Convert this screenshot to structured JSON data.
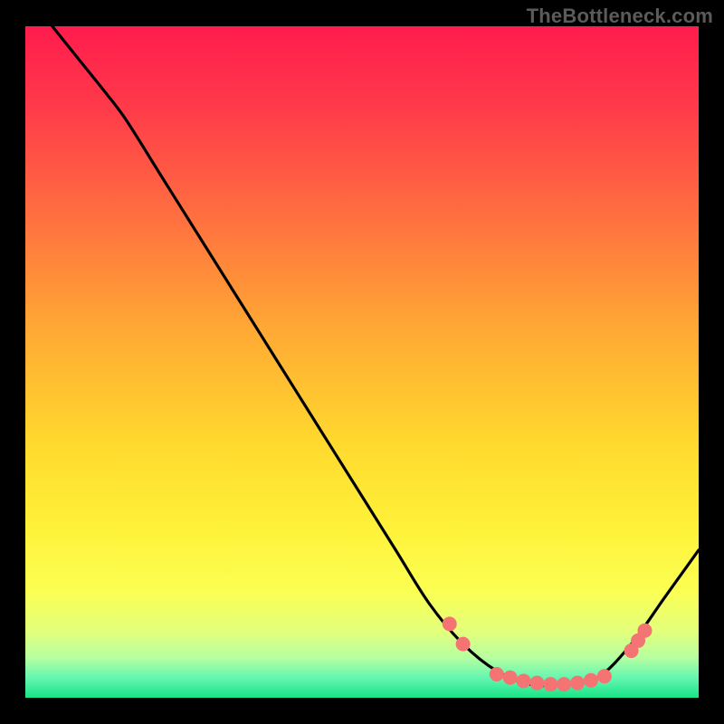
{
  "attribution": "TheBottleneck.com",
  "chart_data": {
    "type": "line",
    "title": "",
    "xlabel": "",
    "ylabel": "",
    "xlim": [
      0,
      100
    ],
    "ylim": [
      0,
      100
    ],
    "background_gradient": {
      "direction": "vertical",
      "stops": [
        {
          "pct": 0,
          "color": "#ff1c4d"
        },
        {
          "pct": 12,
          "color": "#ff3a4a"
        },
        {
          "pct": 28,
          "color": "#ff6e40"
        },
        {
          "pct": 45,
          "color": "#ffa834"
        },
        {
          "pct": 62,
          "color": "#ffd92e"
        },
        {
          "pct": 75,
          "color": "#fff23a"
        },
        {
          "pct": 84,
          "color": "#fbff52"
        },
        {
          "pct": 90,
          "color": "#e4ff7a"
        },
        {
          "pct": 94,
          "color": "#b6ffa0"
        },
        {
          "pct": 97,
          "color": "#66f6b0"
        },
        {
          "pct": 100,
          "color": "#18e487"
        }
      ]
    },
    "curve": {
      "color": "#000000",
      "points": [
        {
          "x": 4,
          "y": 100
        },
        {
          "x": 8,
          "y": 95
        },
        {
          "x": 12,
          "y": 90
        },
        {
          "x": 15,
          "y": 86
        },
        {
          "x": 20,
          "y": 78
        },
        {
          "x": 25,
          "y": 70
        },
        {
          "x": 30,
          "y": 62
        },
        {
          "x": 35,
          "y": 54
        },
        {
          "x": 40,
          "y": 46
        },
        {
          "x": 45,
          "y": 38
        },
        {
          "x": 50,
          "y": 30
        },
        {
          "x": 55,
          "y": 22
        },
        {
          "x": 60,
          "y": 14
        },
        {
          "x": 65,
          "y": 8
        },
        {
          "x": 70,
          "y": 4
        },
        {
          "x": 75,
          "y": 2
        },
        {
          "x": 80,
          "y": 2
        },
        {
          "x": 85,
          "y": 3
        },
        {
          "x": 90,
          "y": 8
        },
        {
          "x": 95,
          "y": 15
        },
        {
          "x": 100,
          "y": 22
        }
      ]
    },
    "markers": {
      "color": "#f47474",
      "radius": 8,
      "points": [
        {
          "x": 63,
          "y": 11
        },
        {
          "x": 65,
          "y": 8
        },
        {
          "x": 70,
          "y": 3.5
        },
        {
          "x": 72,
          "y": 3
        },
        {
          "x": 74,
          "y": 2.5
        },
        {
          "x": 76,
          "y": 2.2
        },
        {
          "x": 78,
          "y": 2
        },
        {
          "x": 80,
          "y": 2
        },
        {
          "x": 82,
          "y": 2.2
        },
        {
          "x": 84,
          "y": 2.6
        },
        {
          "x": 86,
          "y": 3.2
        },
        {
          "x": 90,
          "y": 7
        },
        {
          "x": 91,
          "y": 8.5
        },
        {
          "x": 92,
          "y": 10
        }
      ]
    }
  }
}
